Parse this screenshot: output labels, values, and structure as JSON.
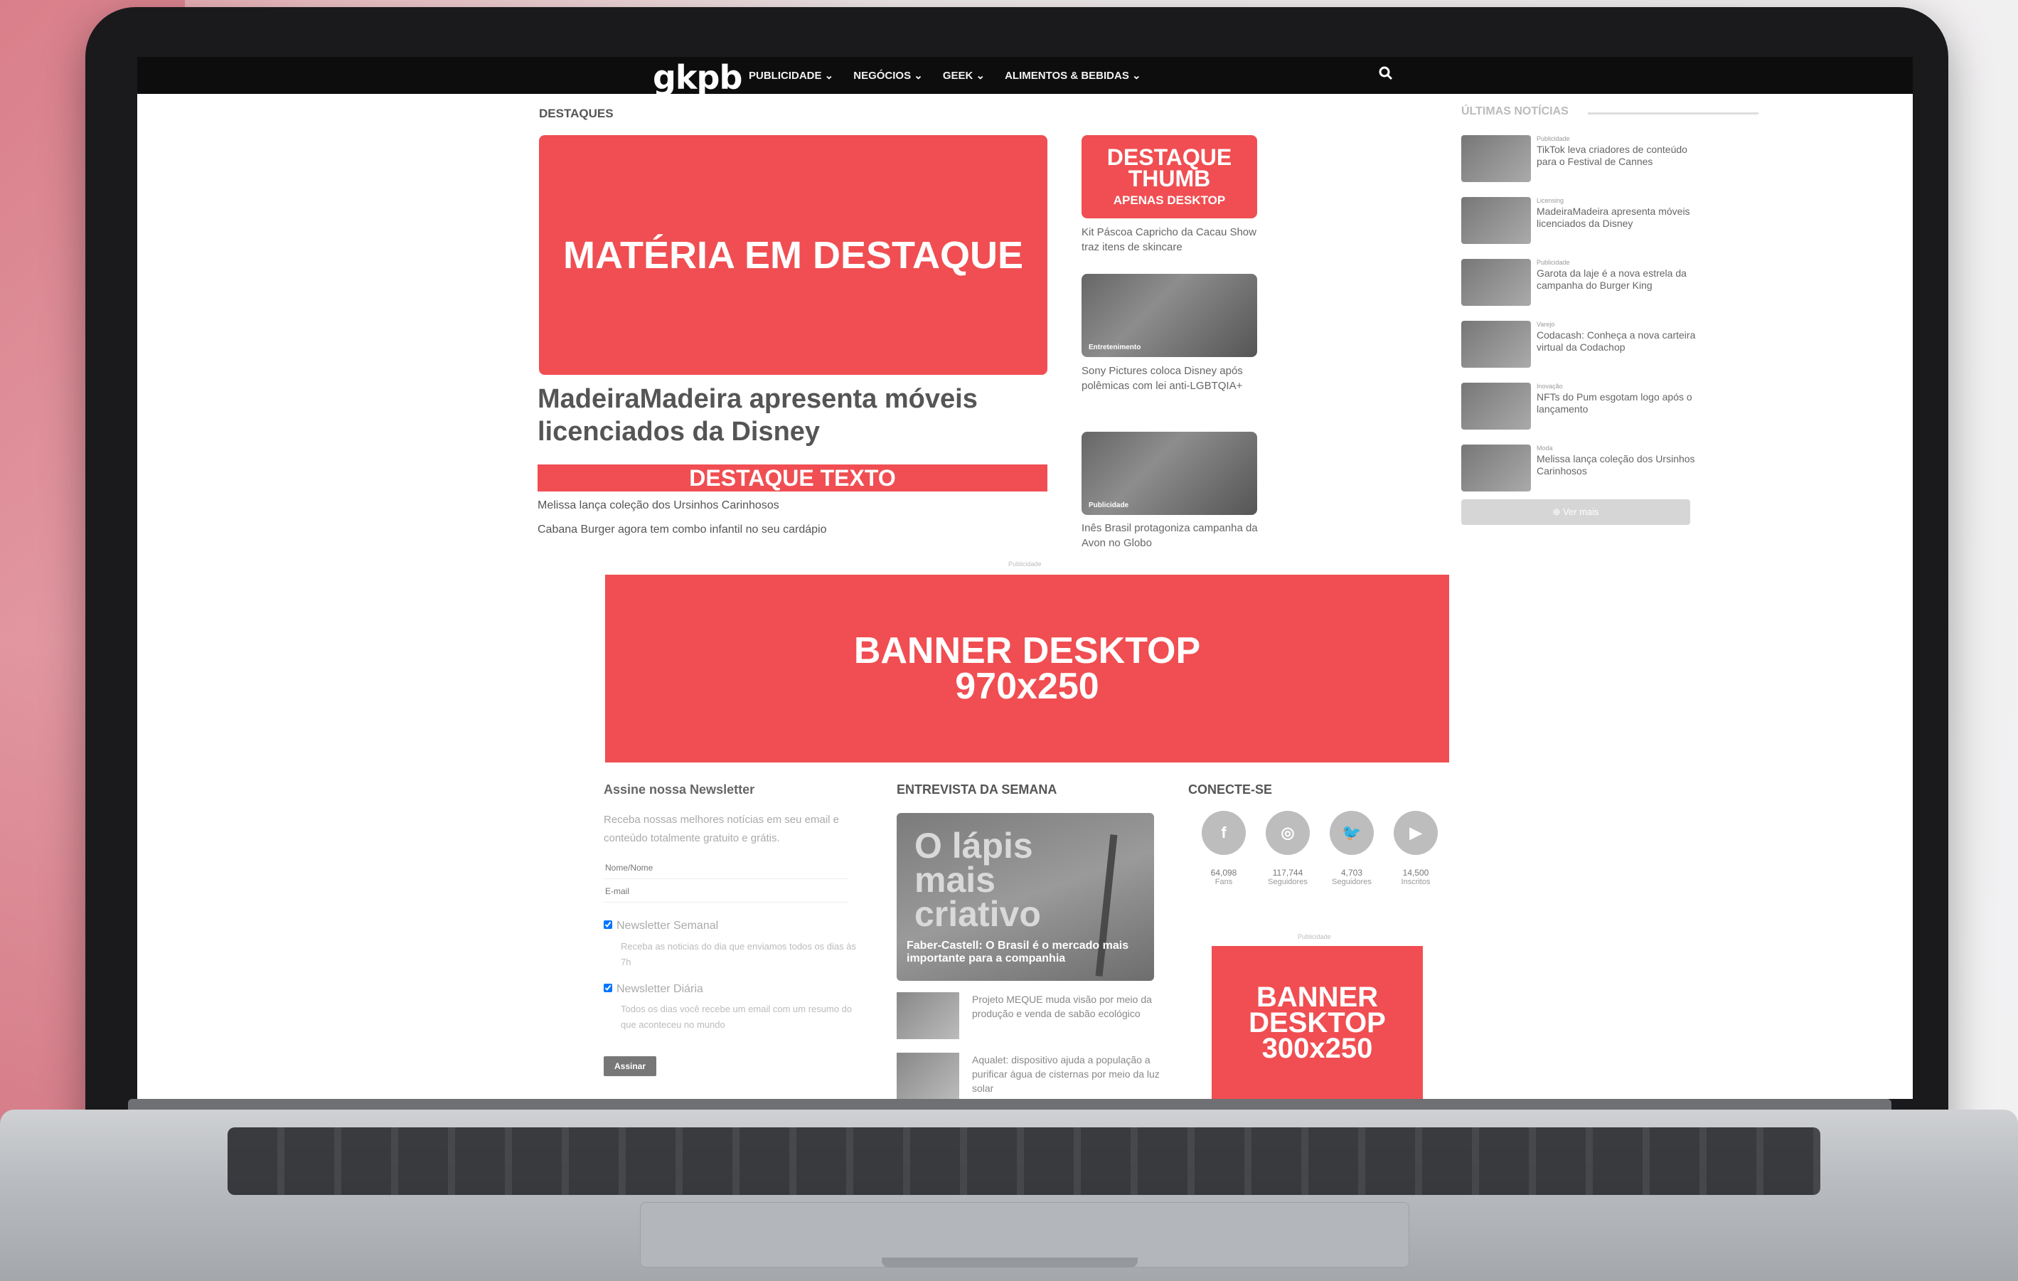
{
  "site": {
    "logo": "gkpb",
    "nav": [
      "PUBLICIDADE ⌄",
      "NEGÓCIOS ⌄",
      "GEEK ⌄",
      "ALIMENTOS & BEBIDAS ⌄"
    ]
  },
  "destaques": {
    "label": "DESTAQUES",
    "featured_box": "MATÉRIA EM DESTAQUE",
    "featured_title": "MadeiraMadeira apresenta móveis licenciados da Disney",
    "destaque_texto": "DESTAQUE TEXTO",
    "links": [
      "Melissa lança coleção dos Ursinhos Carinhosos",
      "Cabana Burger agora tem combo infantil no seu cardápio"
    ]
  },
  "middle": {
    "thumb_line1": "DESTAQUE",
    "thumb_line2": "THUMB",
    "thumb_sub": "APENAS DESKTOP",
    "caption1": "Kit Páscoa Capricho da Cacau Show traz itens de skincare",
    "photo1_tag": "Entretenimento",
    "caption2": "Sony Pictures coloca Disney após polêmicas com lei anti-LGBTQIA+",
    "photo2_tag": "Publicidade",
    "caption3": "Inês Brasil protagoniza campanha da Avon no Globo"
  },
  "latest": {
    "title": "ÚLTIMAS NOTÍCIAS",
    "items": [
      {
        "cat": "Publicidade",
        "title": "TikTok leva criadores de conteúdo para o Festival de Cannes"
      },
      {
        "cat": "Licensing",
        "title": "MadeiraMadeira apresenta móveis licenciados da Disney"
      },
      {
        "cat": "Publicidade",
        "title": "Garota da laje é a nova estrela da campanha do Burger King"
      },
      {
        "cat": "Varejo",
        "title": "Codacash: Conheça a nova carteira virtual da Codachop"
      },
      {
        "cat": "Inovação",
        "title": "NFTs do Pum esgotam logo após o lançamento"
      },
      {
        "cat": "Moda",
        "title": "Melissa lança coleção dos Ursinhos Carinhosos"
      }
    ],
    "more": "⊕ Ver mais"
  },
  "ads": {
    "label": "Publicidade",
    "banner970_line1": "BANNER DESKTOP",
    "banner970_line2": "970x250",
    "banner300_line1": "BANNER",
    "banner300_line2": "DESKTOP",
    "banner300_line3": "300x250"
  },
  "newsletter": {
    "title": "Assine nossa Newsletter",
    "desc": "Receba nossas melhores notícias em seu email e conteúdo totalmente gratuito e grátis.",
    "name_placeholder": "Nome/Nome",
    "email_placeholder": "E-mail",
    "option1": "Newsletter Semanal",
    "option1_desc": "Receba as noticias do dia que enviamos todos os dias às 7h",
    "option2": "Newsletter Diária",
    "option2_desc": "Todos os dias você recebe um email com um resumo do que aconteceu no mundo",
    "submit": "Assinar"
  },
  "entrevista": {
    "title": "ENTREVISTA DA SEMANA",
    "headline": "O lápis mais criativo",
    "caption": "Faber-Castell: O Brasil é o mercado mais importante para a companhia",
    "items": [
      "Projeto MEQUE muda visão por meio da produção e venda de sabão ecológico",
      "Aqualet: dispositivo ajuda a população a purificar água de cisternas por meio da luz solar"
    ]
  },
  "conecte": {
    "title": "CONECTE-SE",
    "networks": [
      {
        "icon": "f",
        "count": "64,098",
        "unit": "Fans"
      },
      {
        "icon": "◎",
        "count": "117,744",
        "unit": "Seguidores"
      },
      {
        "icon": "🐦",
        "count": "4,703",
        "unit": "Seguidores"
      },
      {
        "icon": "▶",
        "count": "14,500",
        "unit": "Inscritos"
      }
    ]
  },
  "colors": {
    "accent": "#f04e52",
    "topbar": "#0d0d0d"
  }
}
